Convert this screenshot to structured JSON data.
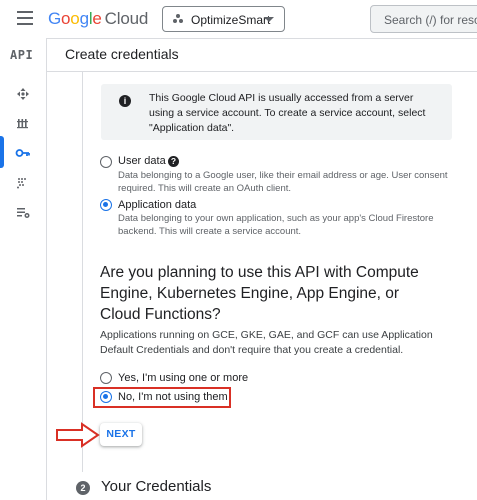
{
  "app": {
    "logo_google": "Google",
    "logo_cloud": "Cloud",
    "project_name": "OptimizeSmart",
    "search_placeholder": "Search (/) for resou"
  },
  "rail": {
    "api_label": "API",
    "items": [
      {
        "icon": "dashboard-icon",
        "active": false
      },
      {
        "icon": "library-icon",
        "active": false
      },
      {
        "icon": "key-icon",
        "active": true
      },
      {
        "icon": "consent-screen-icon",
        "active": false
      },
      {
        "icon": "settings-list-icon",
        "active": false
      }
    ]
  },
  "header": {
    "title": "Create credentials"
  },
  "info": {
    "text": "This Google Cloud API is usually accessed from a server using a service account. To create a service account, select \"Application data\"."
  },
  "data_type": {
    "options": [
      {
        "label": "User data",
        "description": "Data belonging to a Google user, like their email address or age. User consent required. This will create an OAuth client.",
        "checked": false
      },
      {
        "label": "Application data",
        "description": "Data belonging to your own application, such as your app's Cloud Firestore backend. This will create a service account.",
        "checked": true
      }
    ]
  },
  "compute": {
    "question": "Are you planning to use this API with Compute Engine, Kubernetes Engine, App Engine, or Cloud Functions?",
    "description": "Applications running on GCE, GKE, GAE, and GCF can use Application Default Credentials and don't require that you create a credential.",
    "options": [
      {
        "label": "Yes, I'm using one or more",
        "checked": false
      },
      {
        "label": "No, I'm not using them",
        "checked": true
      }
    ]
  },
  "next_label": "NEXT",
  "step2": {
    "number": "2",
    "title": "Your Credentials"
  },
  "colors": {
    "accent": "#1a73e8",
    "highlight": "#d93025",
    "google_blue": "#4285f4",
    "google_red": "#ea4335",
    "google_yellow": "#fbbc04",
    "google_green": "#34a853"
  }
}
